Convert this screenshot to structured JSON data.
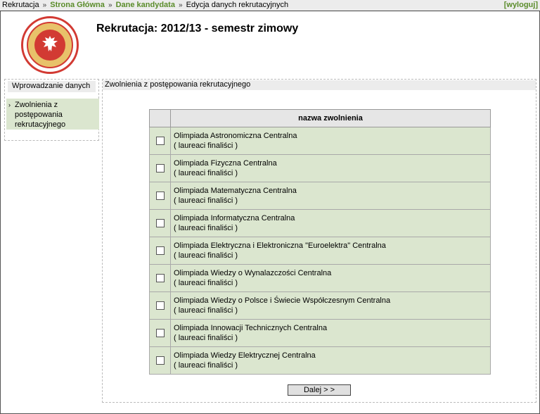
{
  "breadcrumb": {
    "root": "Rekrutacja",
    "sep": "»",
    "home": "Strona Główna",
    "candidate": "Dane kandydata",
    "current": "Edycja danych rekrutacyjnych"
  },
  "logout": "[wyloguj]",
  "page_title": "Rekrutacja: 2012/13 - semestr zimowy",
  "sidebar": {
    "title": "Wprowadzanie danych",
    "item_arrow": "›",
    "item_label": "Zwolnienia z postępowania rekrutacyjnego"
  },
  "content": {
    "title": "Zwolnienia z postępowania rekrutacyjnego",
    "column_header": "nazwa zwolnienia",
    "rows": [
      {
        "name": "Olimpiada Astronomiczna Centralna",
        "sub": "( laureaci finaliści )"
      },
      {
        "name": "Olimpiada Fizyczna Centralna",
        "sub": "( laureaci finaliści )"
      },
      {
        "name": "Olimpiada Matematyczna Centralna",
        "sub": "( laureaci finaliści )"
      },
      {
        "name": "Olimpiada Informatyczna Centralna",
        "sub": "( laureaci finaliści )"
      },
      {
        "name": "Olimpiada Elektryczna i Elektroniczna \"Euroelektra\" Centralna",
        "sub": "( laureaci finaliści )"
      },
      {
        "name": "Olimpiada Wiedzy o Wynalazczości Centralna",
        "sub": "( laureaci finaliści )"
      },
      {
        "name": "Olimpiada Wiedzy o Polsce i Świecie Współczesnym Centralna",
        "sub": "( laureaci finaliści )"
      },
      {
        "name": "Olimpiada Innowacji Technicznych Centralna",
        "sub": "( laureaci finaliści )"
      },
      {
        "name": "Olimpiada Wiedzy Elektrycznej Centralna",
        "sub": "( laureaci finaliści )"
      }
    ],
    "next_label": "Dalej > >"
  },
  "colors": {
    "link_green": "#5a8c2a",
    "row_green": "#dbe6cf",
    "header_gray": "#ececec",
    "logo_red": "#d23a33"
  }
}
